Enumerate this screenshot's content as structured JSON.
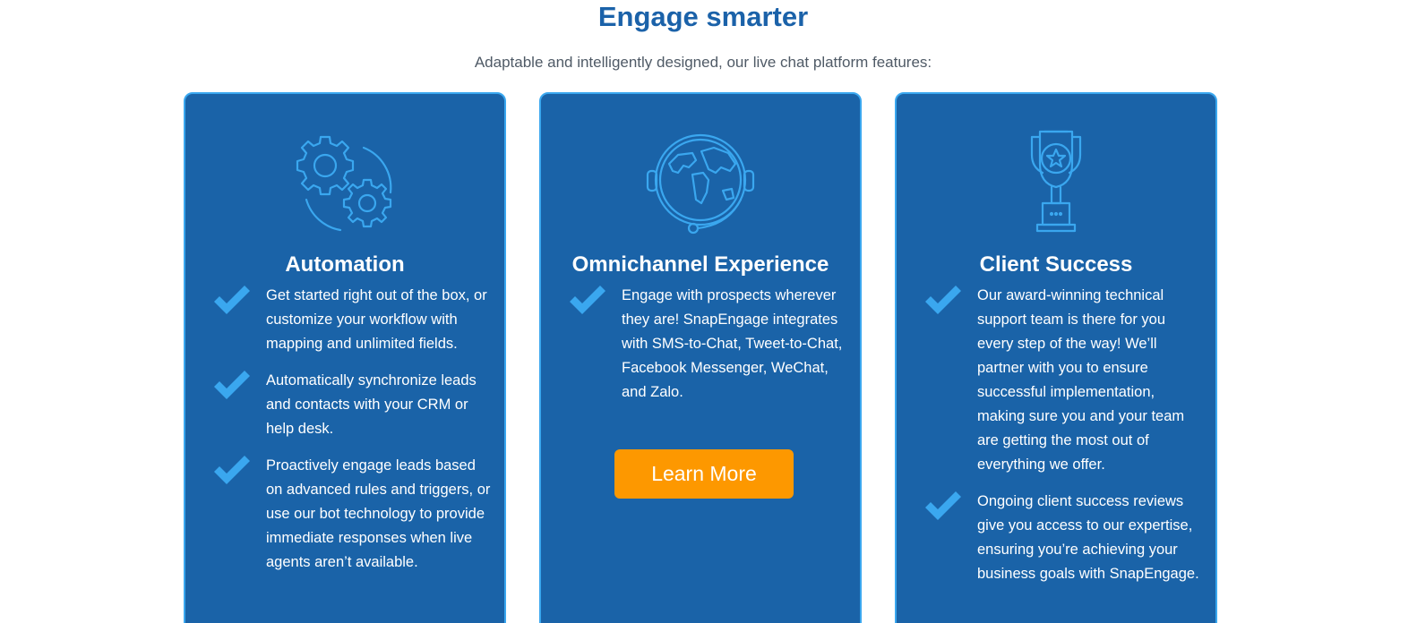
{
  "section": {
    "heading": "Engage smarter",
    "subheading": "Adaptable and intelligently designed, our live chat platform features:"
  },
  "colors": {
    "heading": "#1b62a9",
    "card_background": "#1a63a8",
    "card_border": "#3aa7ef",
    "icon_stroke": "#3aa7ef",
    "check": "#3aa7ef",
    "button": "#fd9800"
  },
  "cards": [
    {
      "icon": "gears-icon",
      "title": "Automation",
      "features": [
        "Get started right out of the box, or customize your workflow with mapping and unlimited fields.",
        "Automatically synchronize leads and contacts with your CRM or help desk.",
        "Proactively engage leads based on advanced rules and triggers, or use our bot technology to provide immediate responses when live agents aren’t available."
      ]
    },
    {
      "icon": "globe-headset-icon",
      "title": "Omnichannel Experience",
      "features": [
        "Engage with prospects wherever they are! SnapEngage integrates with SMS-to-Chat, Tweet-to-Chat, Facebook Messenger, WeChat, and Zalo."
      ],
      "button_label": "Learn More"
    },
    {
      "icon": "trophy-icon",
      "title": "Client Success",
      "features": [
        "Our award-winning technical support team is there for you every step of the way! We’ll partner with you to ensure successful implementation, making sure you and your team are getting the most out of everything we offer.",
        "Ongoing client success reviews give you access to our expertise, ensuring you’re achieving your business goals with SnapEngage."
      ]
    }
  ]
}
